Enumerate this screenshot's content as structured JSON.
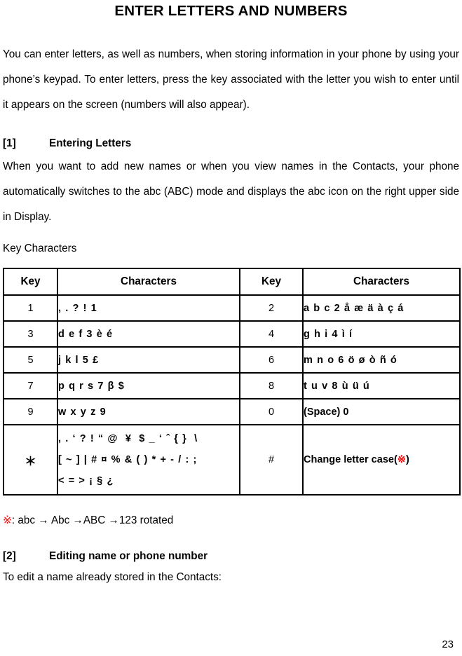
{
  "document": {
    "title": "ENTER LETTERS AND NUMBERS",
    "intro_paragraph": "You can enter letters, as well as numbers, when storing information in your phone by using your phone’s keypad. To enter letters, press the key associated with the letter you wish to enter until it appears on the screen (numbers will also appear).",
    "page_number": "23"
  },
  "section1": {
    "number": "[1]",
    "heading": "Entering Letters",
    "body": "When you want to add new names or when you view names in the Contacts, your phone automatically switches to the abc (ABC) mode and displays the abc icon on the right upper side in Display.",
    "table_caption": "Key Characters"
  },
  "table": {
    "headers": [
      "Key",
      "Characters",
      "Key",
      "Characters"
    ],
    "rows": [
      {
        "key_left": "1",
        "chars_left": [
          ", . ? ! 1"
        ],
        "key_right": "2",
        "chars_right": [
          "a b c 2 å æ ä à ç á"
        ]
      },
      {
        "key_left": "3",
        "chars_left": [
          "d e f 3 è é"
        ],
        "key_right": "4",
        "chars_right": [
          "g h i 4 ì í"
        ]
      },
      {
        "key_left": "5",
        "chars_left": [
          "j k l 5 £"
        ],
        "key_right": "6",
        "chars_right": [
          "m n o 6 ö ø ò ñ ó"
        ]
      },
      {
        "key_left": "7",
        "chars_left": [
          "p q r s 7 β $"
        ],
        "key_right": "8",
        "chars_right": [
          "t u v 8 ù ü ú"
        ]
      },
      {
        "key_left": "9",
        "chars_left": [
          "w x y z 9"
        ],
        "key_right": "0",
        "chars_right": [
          "(Space) 0"
        ]
      },
      {
        "key_left": "＊",
        "chars_left": [
          ", . ‘ ? ! “ @  ¥  $ _ ‘ ˆ { }  \\",
          "[ ~ ] | # ¤ % & ( ) * + - / : ;",
          "< = > ¡ § ¿"
        ],
        "key_right": "#",
        "chars_right": [
          "Change letter case(※)"
        ]
      }
    ]
  },
  "footnote": {
    "marker": "※",
    "text": ": abc → Abc →ABC →123 rotated"
  },
  "section2": {
    "number": "[2]",
    "heading": "Editing name or phone number",
    "body": "To edit a name already stored in the Contacts:"
  },
  "colors": {
    "text": "#000000",
    "accent_red": "#ff0000",
    "background": "#ffffff"
  }
}
